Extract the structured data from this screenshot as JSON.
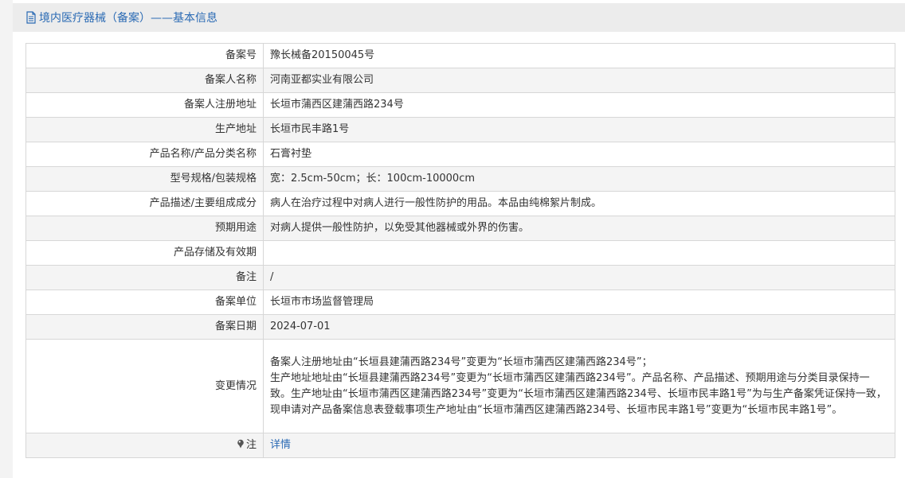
{
  "header": {
    "title": "境内医疗器械（备案）——基本信息",
    "icon": "document-icon"
  },
  "record": {
    "rows": [
      {
        "label": "备案号",
        "value": "豫长械备20150045号"
      },
      {
        "label": "备案人名称",
        "value": "河南亚都实业有限公司"
      },
      {
        "label": "备案人注册地址",
        "value": "长垣市蒲西区建蒲西路234号"
      },
      {
        "label": "生产地址",
        "value": "长垣市民丰路1号"
      },
      {
        "label": "产品名称/产品分类名称",
        "value": "石膏衬垫"
      },
      {
        "label": "型号规格/包装规格",
        "value": "宽：2.5cm-50cm；长：100cm-10000cm"
      },
      {
        "label": "产品描述/主要组成成分",
        "value": "病人在治疗过程中对病人进行一般性防护的用品。本品由纯棉絮片制成。"
      },
      {
        "label": "预期用途",
        "value": "对病人提供一般性防护，以免受其他器械或外界的伤害。"
      },
      {
        "label": "产品存储及有效期",
        "value": ""
      },
      {
        "label": "备注",
        "value": "/"
      },
      {
        "label": "备案单位",
        "value": "长垣市市场监督管理局"
      },
      {
        "label": "备案日期",
        "value": "2024-07-01"
      }
    ],
    "changes": {
      "label": "变更情况",
      "line1": "备案人注册地址由“长垣县建蒲西路234号”变更为“长垣市蒲西区建蒲西路234号”；",
      "line2": "生产地址地址由“长垣县建蒲西路234号”变更为“长垣市蒲西区建蒲西路234号”。产品名称、产品描述、预期用途与分类目录保持一致。生产地址由“长垣市蒲西区建蒲西路234号”变更为“长垣市蒲西区建蒲西路234号、长垣市民丰路1号”为与生产备案凭证保持一致，现申请对产品备案信息表登载事项生产地址由“长垣市蒲西区建蒲西路234号、长垣市民丰路1号”变更为“长垣市民丰路1号”。"
    },
    "note": {
      "label": "注",
      "icon": "pin-icon",
      "link": "详情"
    }
  }
}
